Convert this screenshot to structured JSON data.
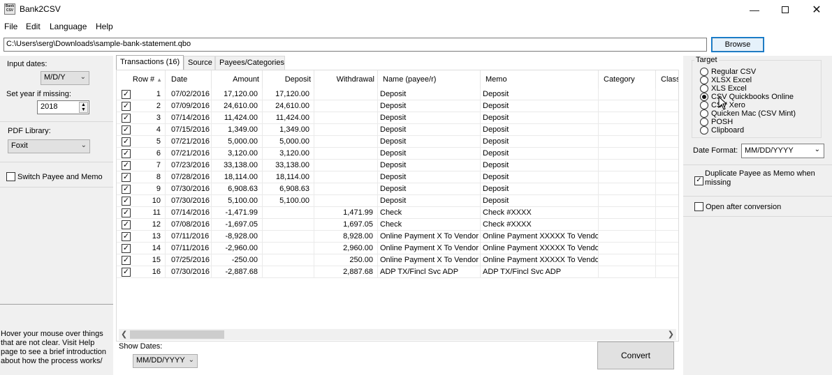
{
  "window": {
    "title": "Bank2CSV",
    "icon_text": "Bank CSV",
    "controls": [
      "minimize",
      "maximize",
      "close"
    ]
  },
  "menu": [
    "File",
    "Edit",
    "Language",
    "Help"
  ],
  "file_path": {
    "value": "C:\\Users\\serg\\Downloads\\sample-bank-statement.qbo",
    "browse_label": "Browse"
  },
  "left": {
    "input_dates_label": "Input dates:",
    "input_dates_value": "M/D/Y",
    "year_label": "Set year if missing:",
    "year_value": "2018",
    "pdf_label": "PDF Library:",
    "pdf_value": "Foxit",
    "switch_label": "Switch Payee and Memo",
    "hint": "Hover your mouse over things that are not clear. Visit Help page to see a brief introduction about how the process works/"
  },
  "tabs": [
    "Transactions (16)",
    "Source",
    "Payees/Categories"
  ],
  "grid": {
    "columns": [
      "Row #",
      "Date",
      "Amount",
      "Deposit",
      "Withdrawal",
      "Name (payee/r)",
      "Memo",
      "Category",
      "Class"
    ],
    "rows": [
      {
        "n": "1",
        "date": "07/02/2016",
        "amount": "17,120.00",
        "deposit": "17,120.00",
        "withdrawal": "",
        "name": "Deposit",
        "memo": "Deposit"
      },
      {
        "n": "2",
        "date": "07/09/2016",
        "amount": "24,610.00",
        "deposit": "24,610.00",
        "withdrawal": "",
        "name": "Deposit",
        "memo": "Deposit"
      },
      {
        "n": "3",
        "date": "07/14/2016",
        "amount": "11,424.00",
        "deposit": "11,424.00",
        "withdrawal": "",
        "name": "Deposit",
        "memo": "Deposit"
      },
      {
        "n": "4",
        "date": "07/15/2016",
        "amount": "1,349.00",
        "deposit": "1,349.00",
        "withdrawal": "",
        "name": "Deposit",
        "memo": "Deposit"
      },
      {
        "n": "5",
        "date": "07/21/2016",
        "amount": "5,000.00",
        "deposit": "5,000.00",
        "withdrawal": "",
        "name": "Deposit",
        "memo": "Deposit"
      },
      {
        "n": "6",
        "date": "07/21/2016",
        "amount": "3,120.00",
        "deposit": "3,120.00",
        "withdrawal": "",
        "name": "Deposit",
        "memo": "Deposit"
      },
      {
        "n": "7",
        "date": "07/23/2016",
        "amount": "33,138.00",
        "deposit": "33,138.00",
        "withdrawal": "",
        "name": "Deposit",
        "memo": "Deposit"
      },
      {
        "n": "8",
        "date": "07/28/2016",
        "amount": "18,114.00",
        "deposit": "18,114.00",
        "withdrawal": "",
        "name": "Deposit",
        "memo": "Deposit"
      },
      {
        "n": "9",
        "date": "07/30/2016",
        "amount": "6,908.63",
        "deposit": "6,908.63",
        "withdrawal": "",
        "name": "Deposit",
        "memo": "Deposit"
      },
      {
        "n": "10",
        "date": "07/30/2016",
        "amount": "5,100.00",
        "deposit": "5,100.00",
        "withdrawal": "",
        "name": "Deposit",
        "memo": "Deposit"
      },
      {
        "n": "11",
        "date": "07/14/2016",
        "amount": "-1,471.99",
        "deposit": "",
        "withdrawal": "1,471.99",
        "name": "Check",
        "memo": "Check #XXXX"
      },
      {
        "n": "12",
        "date": "07/08/2016",
        "amount": "-1,697.05",
        "deposit": "",
        "withdrawal": "1,697.05",
        "name": "Check",
        "memo": "Check #XXXX"
      },
      {
        "n": "13",
        "date": "07/11/2016",
        "amount": "-8,928.00",
        "deposit": "",
        "withdrawal": "8,928.00",
        "name": "Online Payment X To Vendor",
        "memo": "Online Payment XXXXX To Vendor"
      },
      {
        "n": "14",
        "date": "07/11/2016",
        "amount": "-2,960.00",
        "deposit": "",
        "withdrawal": "2,960.00",
        "name": "Online Payment X To Vendor",
        "memo": "Online Payment XXXXX To Vendor"
      },
      {
        "n": "15",
        "date": "07/25/2016",
        "amount": "-250.00",
        "deposit": "",
        "withdrawal": "250.00",
        "name": "Online Payment X To Vendor",
        "memo": "Online Payment XXXXX To Vendor"
      },
      {
        "n": "16",
        "date": "07/30/2016",
        "amount": "-2,887.68",
        "deposit": "",
        "withdrawal": "2,887.68",
        "name": "ADP TX/Fincl Svc ADP",
        "memo": "ADP TX/Fincl Svc ADP"
      }
    ]
  },
  "bottom": {
    "show_dates_label": "Show Dates:",
    "show_dates_value": "MM/DD/YYYY",
    "convert_label": "Convert"
  },
  "right": {
    "target_label": "Target",
    "targets": [
      "Regular CSV",
      "XLSX Excel",
      "XLS Excel",
      "CSV Quickbooks Online",
      "CSV Xero",
      "Quicken Mac (CSV Mint)",
      "POSH",
      "Clipboard"
    ],
    "selected_target": "CSV Quickbooks Online",
    "date_format_label": "Date Format:",
    "date_format_value": "MM/DD/YYYY",
    "duplicate_label": "Duplicate Payee as Memo when missing",
    "open_after_label": "Open after conversion"
  }
}
